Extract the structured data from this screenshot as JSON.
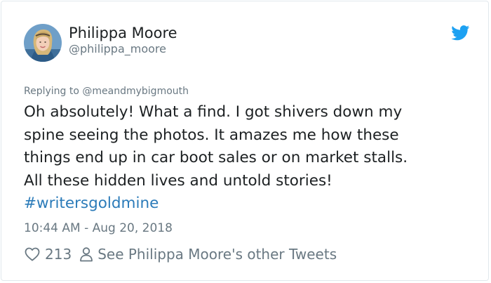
{
  "author": {
    "name": "Philippa Moore",
    "handle": "@philippa_moore",
    "avatar_icon": "profile-photo"
  },
  "brand": {
    "icon": "twitter-bird-icon",
    "color": "#1da1f2"
  },
  "tweet": {
    "reply_prefix": "Replying to",
    "reply_to": "@meandmybigmouth",
    "text_lines": [
      "Oh absolutely! What a find. I got shivers down my",
      "spine seeing the photos. It amazes me how these",
      "things end up in car boot sales or on market stalls.",
      "All these hidden lives and untold stories!"
    ],
    "hashtag": "#writersgoldmine",
    "timestamp": "10:44 AM - Aug 20, 2018"
  },
  "actions": {
    "like_icon": "heart-icon",
    "like_count": "213",
    "profile_icon": "person-icon",
    "other_tweets_label": "See Philippa Moore's other Tweets"
  },
  "colors": {
    "text": "#1c2022",
    "muted": "#697882",
    "link": "#2b7bb9",
    "border": "#e1e8ed"
  }
}
